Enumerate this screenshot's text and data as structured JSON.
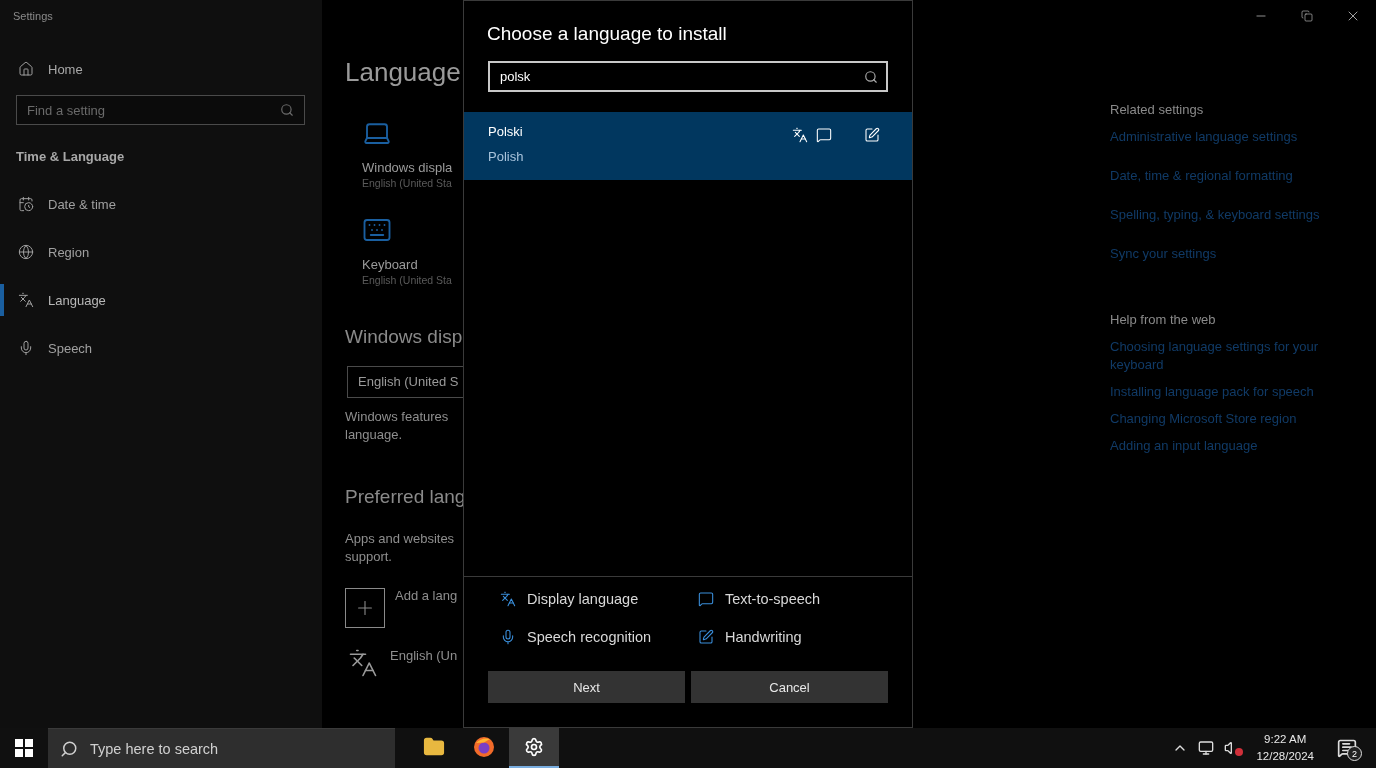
{
  "window": {
    "title": "Settings"
  },
  "sidebar": {
    "home": "Home",
    "search": {
      "placeholder": "Find a setting"
    },
    "section": "Time & Language",
    "items": [
      {
        "label": "Date & time",
        "kind": "calendar",
        "selected": false
      },
      {
        "label": "Region",
        "kind": "region",
        "selected": false
      },
      {
        "label": "Language",
        "kind": "language",
        "selected": true
      },
      {
        "label": "Speech",
        "kind": "speech",
        "selected": false
      }
    ]
  },
  "main": {
    "heading": "Language",
    "tiles": [
      {
        "kind": "display",
        "title": "Windows displa",
        "subtitle": "English (United Sta"
      },
      {
        "kind": "keyboard",
        "title": "Keyboard",
        "subtitle": "English (United Sta"
      }
    ],
    "display_language": {
      "heading": "Windows disp",
      "dropdown": "English (United S",
      "description": [
        "Windows features",
        "language."
      ]
    },
    "preferred": {
      "heading": "Preferred lang",
      "description": [
        "Apps and websites",
        "support."
      ],
      "add": "Add a lang",
      "languages": [
        "English (Un"
      ]
    }
  },
  "related": {
    "heading": "Related settings",
    "links": [
      "Administrative language settings",
      "Date, time & regional formatting",
      "Spelling, typing, & keyboard settings",
      "Sync your settings"
    ]
  },
  "help": {
    "heading": "Help from the web",
    "links": [
      "Choosing language settings for your keyboard",
      "Installing language pack for speech",
      "Changing Microsoft Store region",
      "Adding an input language"
    ]
  },
  "dialog": {
    "title": "Choose a language to install",
    "search": {
      "value": "polsk"
    },
    "results": [
      {
        "name": "Polski",
        "english": "Polish",
        "selected": true,
        "features": [
          {
            "kind": "display_language"
          },
          {
            "kind": "text_to_speech"
          },
          {
            "kind": "handwriting"
          }
        ]
      }
    ],
    "legend": [
      {
        "kind": "display_language",
        "label": "Display language"
      },
      {
        "kind": "text_to_speech",
        "label": "Text-to-speech"
      },
      {
        "kind": "speech_recognition",
        "label": "Speech recognition"
      },
      {
        "kind": "handwriting",
        "label": "Handwriting"
      }
    ],
    "buttons": [
      "Next",
      "Cancel"
    ]
  },
  "taskbar": {
    "search": {
      "placeholder": "Type here to search"
    },
    "apps": [
      {
        "kind": "files",
        "selected": false
      },
      {
        "kind": "browser",
        "selected": false
      },
      {
        "kind": "settings",
        "selected": true
      }
    ],
    "time": "9:22 AM",
    "date": "12/28/2024",
    "notifications": "2"
  }
}
